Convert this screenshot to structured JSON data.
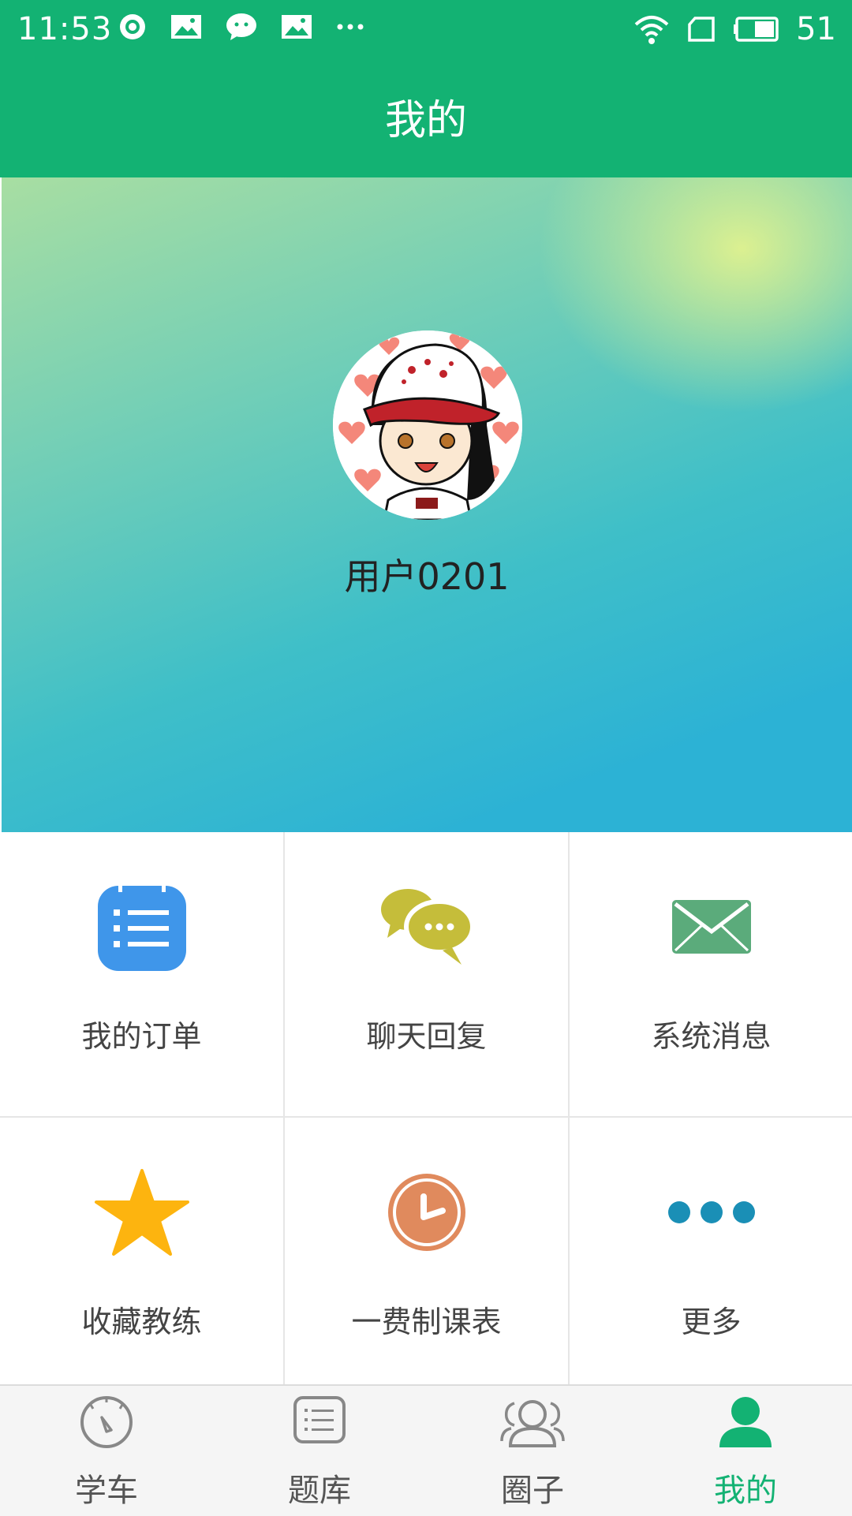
{
  "status_bar": {
    "time": "11:53",
    "battery": "51",
    "icons": [
      "target-icon",
      "image-icon",
      "chat-icon",
      "image-icon",
      "more-icon",
      "wifi-icon",
      "sim-icon",
      "battery-icon"
    ]
  },
  "header": {
    "title": "我的"
  },
  "profile": {
    "username": "用户0201"
  },
  "menu": {
    "items": [
      {
        "label": "我的订单",
        "icon": "orders-icon",
        "color": "#3f96ea"
      },
      {
        "label": "聊天回复",
        "icon": "chat-bubbles-icon",
        "color": "#c5bd3a"
      },
      {
        "label": "系统消息",
        "icon": "envelope-icon",
        "color": "#5bab7b"
      },
      {
        "label": "收藏教练",
        "icon": "star-icon",
        "color": "#fdb40f"
      },
      {
        "label": "一费制课表",
        "icon": "clock-icon",
        "color": "#e08a5d"
      },
      {
        "label": "更多",
        "icon": "more-dots-icon",
        "color": "#1a8fb6"
      }
    ]
  },
  "bottom_nav": {
    "tabs": [
      {
        "label": "学车",
        "icon": "speedometer-icon",
        "active": false
      },
      {
        "label": "题库",
        "icon": "list-icon",
        "active": false
      },
      {
        "label": "圈子",
        "icon": "group-icon",
        "active": false
      },
      {
        "label": "我的",
        "icon": "person-icon",
        "active": true
      }
    ],
    "active_color": "#13b273"
  },
  "colors": {
    "primary": "#13b273"
  }
}
